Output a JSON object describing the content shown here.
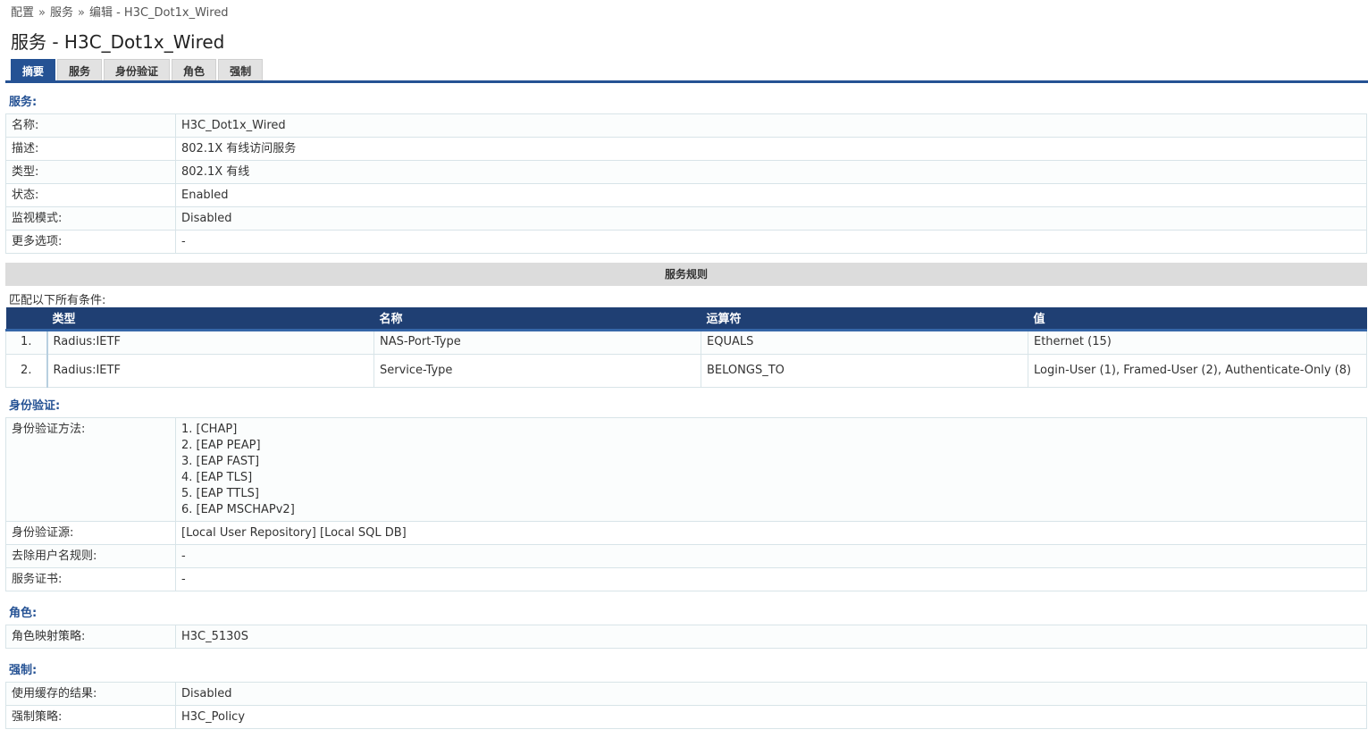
{
  "breadcrumb": {
    "items": [
      "配置",
      "服务",
      "编辑 - H3C_Dot1x_Wired"
    ],
    "separator": "»"
  },
  "page": {
    "title": "服务 - H3C_Dot1x_Wired"
  },
  "tabs": [
    {
      "label": "摘要",
      "active": true
    },
    {
      "label": "服务",
      "active": false
    },
    {
      "label": "身份验证",
      "active": false
    },
    {
      "label": "角色",
      "active": false
    },
    {
      "label": "强制",
      "active": false
    }
  ],
  "service": {
    "section_title": "服务:",
    "rows": [
      {
        "label": "名称:",
        "value": "H3C_Dot1x_Wired"
      },
      {
        "label": "描述:",
        "value": "802.1X 有线访问服务"
      },
      {
        "label": "类型:",
        "value": "802.1X 有线"
      },
      {
        "label": "状态:",
        "value": "Enabled"
      },
      {
        "label": "监视模式:",
        "value": "Disabled"
      },
      {
        "label": "更多选项:",
        "value": "-"
      }
    ]
  },
  "service_rules": {
    "title": "服务规则",
    "match_text": "匹配以下所有条件:",
    "columns": [
      "类型",
      "名称",
      "运算符",
      "值"
    ],
    "rows": [
      {
        "index": "1.",
        "type": "Radius:IETF",
        "name": "NAS-Port-Type",
        "operator": "EQUALS",
        "value": "Ethernet (15)"
      },
      {
        "index": "2.",
        "type": "Radius:IETF",
        "name": "Service-Type",
        "operator": "BELONGS_TO",
        "value": "Login-User (1), Framed-User (2), Authenticate-Only (8)"
      }
    ]
  },
  "authentication": {
    "section_title": "身份验证:",
    "methods_label": "身份验证方法:",
    "methods": [
      "1. [CHAP]",
      "2. [EAP PEAP]",
      "3. [EAP FAST]",
      "4. [EAP TLS]",
      "5. [EAP TTLS]",
      "6. [EAP MSCHAPv2]"
    ],
    "rows": [
      {
        "label": "身份验证源:",
        "value": "[Local User Repository] [Local SQL DB]"
      },
      {
        "label": "去除用户名规则:",
        "value": "-"
      },
      {
        "label": "服务证书:",
        "value": "-"
      }
    ]
  },
  "roles": {
    "section_title": "角色:",
    "rows": [
      {
        "label": "角色映射策略:",
        "value": "H3C_5130S"
      }
    ]
  },
  "enforcement": {
    "section_title": "强制:",
    "rows": [
      {
        "label": "使用缓存的结果:",
        "value": "Disabled"
      },
      {
        "label": "强制策略:",
        "value": "H3C_Policy"
      }
    ]
  }
}
